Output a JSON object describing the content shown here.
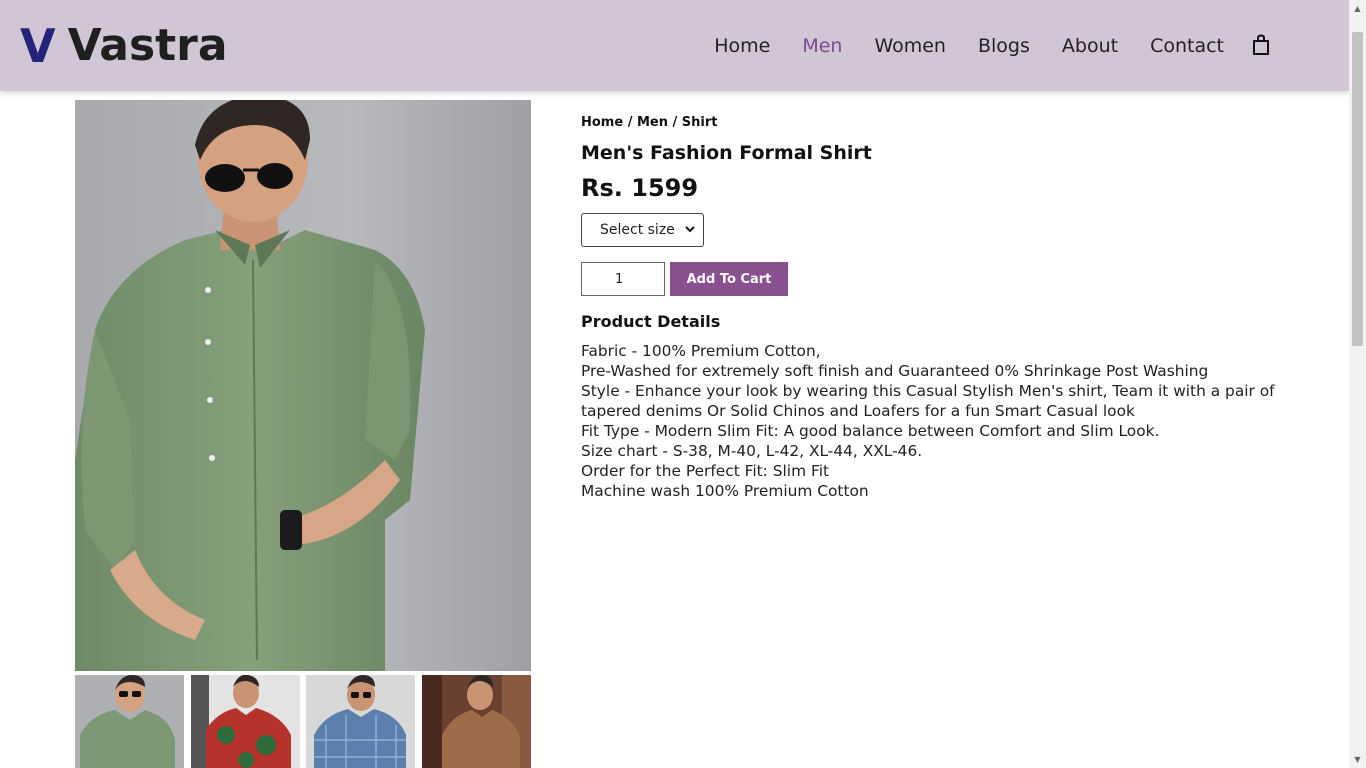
{
  "header": {
    "logo_mark": "V",
    "logo_text": "Vastra",
    "nav": [
      "Home",
      "Men",
      "Women",
      "Blogs",
      "About",
      "Contact"
    ],
    "active_nav": "Men",
    "cart_icon": "shopping-bag-icon"
  },
  "colors": {
    "header_bg": "#d1c6d6",
    "logo_mark": "#24227a",
    "active_nav": "#7a4b8f",
    "button_bg": "#88508f"
  },
  "product": {
    "breadcrumb": "Home / Men / Shirt",
    "title": "Men's Fashion Formal Shirt",
    "price": "Rs. 1599",
    "size_placeholder": "Select size",
    "quantity": "1",
    "add_to_cart_label": "Add To Cart",
    "details_heading": "Product Details",
    "details": [
      "Fabric - 100% Premium Cotton,",
      "Pre-Washed for extremely soft finish and Guaranteed 0% Shrinkage Post Washing",
      "Style - Enhance your look by wearing this Casual Stylish Men's shirt, Team it with a pair of",
      "tapered denims Or Solid Chinos and Loafers for a fun Smart Casual look",
      "Fit Type - Modern Slim Fit: A good balance between Comfort and Slim Look.",
      "Size chart - S-38, M-40, L-42, XL-44, XXL-46.",
      "Order for the Perfect Fit: Slim Fit",
      "Machine wash 100% Premium Cotton"
    ],
    "images": {
      "main": "green-shirt-model-image",
      "thumbnails": [
        "green-shirt-thumbnail",
        "red-floral-shirt-thumbnail",
        "blue-check-shirt-thumbnail",
        "brown-shirt-thumbnail"
      ]
    }
  }
}
